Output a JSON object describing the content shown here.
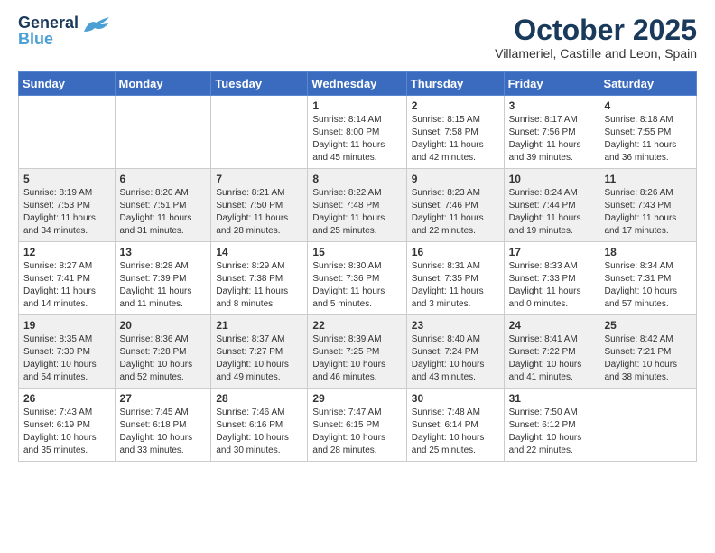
{
  "header": {
    "logo_line1": "General",
    "logo_line2": "Blue",
    "month_title": "October 2025",
    "location": "Villameriel, Castille and Leon, Spain"
  },
  "weekdays": [
    "Sunday",
    "Monday",
    "Tuesday",
    "Wednesday",
    "Thursday",
    "Friday",
    "Saturday"
  ],
  "weeks": [
    [
      {
        "day": "",
        "info": ""
      },
      {
        "day": "",
        "info": ""
      },
      {
        "day": "",
        "info": ""
      },
      {
        "day": "1",
        "info": "Sunrise: 8:14 AM\nSunset: 8:00 PM\nDaylight: 11 hours\nand 45 minutes."
      },
      {
        "day": "2",
        "info": "Sunrise: 8:15 AM\nSunset: 7:58 PM\nDaylight: 11 hours\nand 42 minutes."
      },
      {
        "day": "3",
        "info": "Sunrise: 8:17 AM\nSunset: 7:56 PM\nDaylight: 11 hours\nand 39 minutes."
      },
      {
        "day": "4",
        "info": "Sunrise: 8:18 AM\nSunset: 7:55 PM\nDaylight: 11 hours\nand 36 minutes."
      }
    ],
    [
      {
        "day": "5",
        "info": "Sunrise: 8:19 AM\nSunset: 7:53 PM\nDaylight: 11 hours\nand 34 minutes."
      },
      {
        "day": "6",
        "info": "Sunrise: 8:20 AM\nSunset: 7:51 PM\nDaylight: 11 hours\nand 31 minutes."
      },
      {
        "day": "7",
        "info": "Sunrise: 8:21 AM\nSunset: 7:50 PM\nDaylight: 11 hours\nand 28 minutes."
      },
      {
        "day": "8",
        "info": "Sunrise: 8:22 AM\nSunset: 7:48 PM\nDaylight: 11 hours\nand 25 minutes."
      },
      {
        "day": "9",
        "info": "Sunrise: 8:23 AM\nSunset: 7:46 PM\nDaylight: 11 hours\nand 22 minutes."
      },
      {
        "day": "10",
        "info": "Sunrise: 8:24 AM\nSunset: 7:44 PM\nDaylight: 11 hours\nand 19 minutes."
      },
      {
        "day": "11",
        "info": "Sunrise: 8:26 AM\nSunset: 7:43 PM\nDaylight: 11 hours\nand 17 minutes."
      }
    ],
    [
      {
        "day": "12",
        "info": "Sunrise: 8:27 AM\nSunset: 7:41 PM\nDaylight: 11 hours\nand 14 minutes."
      },
      {
        "day": "13",
        "info": "Sunrise: 8:28 AM\nSunset: 7:39 PM\nDaylight: 11 hours\nand 11 minutes."
      },
      {
        "day": "14",
        "info": "Sunrise: 8:29 AM\nSunset: 7:38 PM\nDaylight: 11 hours\nand 8 minutes."
      },
      {
        "day": "15",
        "info": "Sunrise: 8:30 AM\nSunset: 7:36 PM\nDaylight: 11 hours\nand 5 minutes."
      },
      {
        "day": "16",
        "info": "Sunrise: 8:31 AM\nSunset: 7:35 PM\nDaylight: 11 hours\nand 3 minutes."
      },
      {
        "day": "17",
        "info": "Sunrise: 8:33 AM\nSunset: 7:33 PM\nDaylight: 11 hours\nand 0 minutes."
      },
      {
        "day": "18",
        "info": "Sunrise: 8:34 AM\nSunset: 7:31 PM\nDaylight: 10 hours\nand 57 minutes."
      }
    ],
    [
      {
        "day": "19",
        "info": "Sunrise: 8:35 AM\nSunset: 7:30 PM\nDaylight: 10 hours\nand 54 minutes."
      },
      {
        "day": "20",
        "info": "Sunrise: 8:36 AM\nSunset: 7:28 PM\nDaylight: 10 hours\nand 52 minutes."
      },
      {
        "day": "21",
        "info": "Sunrise: 8:37 AM\nSunset: 7:27 PM\nDaylight: 10 hours\nand 49 minutes."
      },
      {
        "day": "22",
        "info": "Sunrise: 8:39 AM\nSunset: 7:25 PM\nDaylight: 10 hours\nand 46 minutes."
      },
      {
        "day": "23",
        "info": "Sunrise: 8:40 AM\nSunset: 7:24 PM\nDaylight: 10 hours\nand 43 minutes."
      },
      {
        "day": "24",
        "info": "Sunrise: 8:41 AM\nSunset: 7:22 PM\nDaylight: 10 hours\nand 41 minutes."
      },
      {
        "day": "25",
        "info": "Sunrise: 8:42 AM\nSunset: 7:21 PM\nDaylight: 10 hours\nand 38 minutes."
      }
    ],
    [
      {
        "day": "26",
        "info": "Sunrise: 7:43 AM\nSunset: 6:19 PM\nDaylight: 10 hours\nand 35 minutes."
      },
      {
        "day": "27",
        "info": "Sunrise: 7:45 AM\nSunset: 6:18 PM\nDaylight: 10 hours\nand 33 minutes."
      },
      {
        "day": "28",
        "info": "Sunrise: 7:46 AM\nSunset: 6:16 PM\nDaylight: 10 hours\nand 30 minutes."
      },
      {
        "day": "29",
        "info": "Sunrise: 7:47 AM\nSunset: 6:15 PM\nDaylight: 10 hours\nand 28 minutes."
      },
      {
        "day": "30",
        "info": "Sunrise: 7:48 AM\nSunset: 6:14 PM\nDaylight: 10 hours\nand 25 minutes."
      },
      {
        "day": "31",
        "info": "Sunrise: 7:50 AM\nSunset: 6:12 PM\nDaylight: 10 hours\nand 22 minutes."
      },
      {
        "day": "",
        "info": ""
      }
    ]
  ]
}
